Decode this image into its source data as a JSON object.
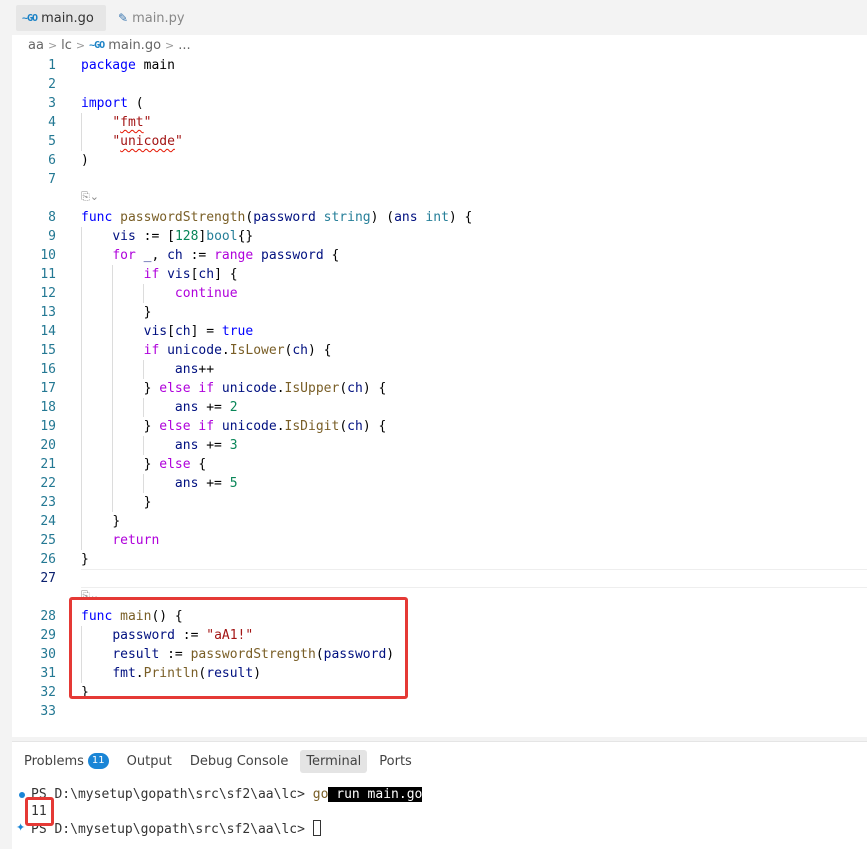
{
  "tabs": [
    {
      "icon": "go-file-icon",
      "icon_text": "~GO",
      "label": "main.go"
    },
    {
      "icon": "python-file-icon",
      "icon_text": "✎",
      "label": "main.py"
    }
  ],
  "breadcrumb": {
    "parts": [
      "aa",
      "lc"
    ],
    "file_icon_text": "~GO",
    "file": "main.go",
    "tail": "..."
  },
  "code_lens": "⎘⌄",
  "code_lines": [
    {
      "n": "1",
      "html": "<span class='k'>package</span> <span class='p'>main</span>"
    },
    {
      "n": "2",
      "html": ""
    },
    {
      "n": "3",
      "html": "<span class='k'>import</span> <span class='p'>(</span>"
    },
    {
      "n": "4",
      "html": "    <span class='s'>\"<span class='sq'>fmt</span>\"</span>"
    },
    {
      "n": "5",
      "html": "    <span class='s'>\"<span class='sq'>unicode</span>\"</span>"
    },
    {
      "n": "6",
      "html": "<span class='p'>)</span>"
    },
    {
      "n": "7",
      "html": ""
    },
    {
      "n": "8",
      "html": "<span class='k'>func</span> <span class='f'>passwordStrength</span><span class='p'>(</span><span class='v'>password</span> <span class='t'>string</span><span class='p'>) (</span><span class='v'>ans</span> <span class='t'>int</span><span class='p'>) {</span>"
    },
    {
      "n": "9",
      "html": "    <span class='v'>vis</span> <span class='p'>:= [</span><span class='n'>128</span><span class='p'>]</span><span class='t'>bool</span><span class='p'>{}</span>"
    },
    {
      "n": "10",
      "html": "    <span class='c'>for</span> <span class='v'>_</span><span class='p'>,</span> <span class='v'>ch</span> <span class='p'>:=</span> <span class='c'>range</span> <span class='v'>password</span> <span class='p'>{</span>"
    },
    {
      "n": "11",
      "html": "        <span class='c'>if</span> <span class='v'>vis</span><span class='p'>[</span><span class='v'>ch</span><span class='p'>] {</span>"
    },
    {
      "n": "12",
      "html": "            <span class='c'>continue</span>"
    },
    {
      "n": "13",
      "html": "        <span class='p'>}</span>"
    },
    {
      "n": "14",
      "html": "        <span class='v'>vis</span><span class='p'>[</span><span class='v'>ch</span><span class='p'>] = </span><span class='k'>true</span>"
    },
    {
      "n": "15",
      "html": "        <span class='c'>if</span> <span class='v'>unicode</span><span class='p'>.</span><span class='f'>IsLower</span><span class='p'>(</span><span class='v'>ch</span><span class='p'>) {</span>"
    },
    {
      "n": "16",
      "html": "            <span class='v'>ans</span><span class='p'>++</span>"
    },
    {
      "n": "17",
      "html": "        <span class='p'>} </span><span class='c'>else if</span> <span class='v'>unicode</span><span class='p'>.</span><span class='f'>IsUpper</span><span class='p'>(</span><span class='v'>ch</span><span class='p'>) {</span>"
    },
    {
      "n": "18",
      "html": "            <span class='v'>ans</span> <span class='p'>+=</span> <span class='n'>2</span>"
    },
    {
      "n": "19",
      "html": "        <span class='p'>} </span><span class='c'>else if</span> <span class='v'>unicode</span><span class='p'>.</span><span class='f'>IsDigit</span><span class='p'>(</span><span class='v'>ch</span><span class='p'>) {</span>"
    },
    {
      "n": "20",
      "html": "            <span class='v'>ans</span> <span class='p'>+=</span> <span class='n'>3</span>"
    },
    {
      "n": "21",
      "html": "        <span class='p'>} </span><span class='c'>else</span> <span class='p'>{</span>"
    },
    {
      "n": "22",
      "html": "            <span class='v'>ans</span> <span class='p'>+=</span> <span class='n'>5</span>"
    },
    {
      "n": "23",
      "html": "        <span class='p'>}</span>"
    },
    {
      "n": "24",
      "html": "    <span class='p'>}</span>"
    },
    {
      "n": "25",
      "html": "    <span class='c'>return</span>"
    },
    {
      "n": "26",
      "html": "<span class='p'>}</span>"
    },
    {
      "n": "27",
      "html": ""
    },
    {
      "n": "28",
      "html": "<span class='k'>func</span> <span class='f'>main</span><span class='p'>() {</span>"
    },
    {
      "n": "29",
      "html": "    <span class='v'>password</span> <span class='p'>:=</span> <span class='s'>\"aA1!\"</span>"
    },
    {
      "n": "30",
      "html": "    <span class='v'>result</span> <span class='p'>:=</span> <span class='f'>passwordStrength</span><span class='p'>(</span><span class='v'>password</span><span class='p'>)</span>"
    },
    {
      "n": "31",
      "html": "    <span class='v'>fmt</span><span class='p'>.</span><span class='f'>Println</span><span class='p'>(</span><span class='v'>result</span><span class='p'>)</span>"
    },
    {
      "n": "32",
      "html": "<span class='p'>}</span>"
    },
    {
      "n": "33",
      "html": ""
    }
  ],
  "panel": {
    "tabs": [
      "Problems",
      "Output",
      "Debug Console",
      "Terminal",
      "Ports"
    ],
    "problems_count": "11",
    "active_tab": "Terminal"
  },
  "terminal": {
    "prompt1": "PS D:\\mysetup\\gopath\\src\\sf2\\aa\\lc> ",
    "cmd_go": "go",
    "cmd_rest": " run main.go",
    "output": "11",
    "prompt2": "PS D:\\mysetup\\gopath\\src\\sf2\\aa\\lc> "
  },
  "colors": {
    "highlight_box": "#e53935",
    "badge": "#1a85d6"
  }
}
